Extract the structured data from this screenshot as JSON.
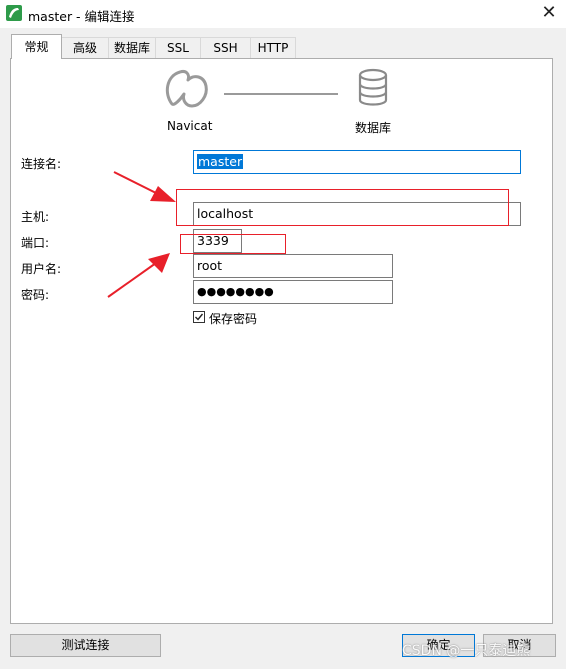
{
  "window": {
    "title": "master - 编辑连接"
  },
  "tabs": [
    {
      "label": "常规"
    },
    {
      "label": "高级"
    },
    {
      "label": "数据库"
    },
    {
      "label": "SSL"
    },
    {
      "label": "SSH"
    },
    {
      "label": "HTTP"
    }
  ],
  "active_tab": "常规",
  "diagram": {
    "left_label": "Navicat",
    "right_label": "数据库"
  },
  "form": {
    "connection_name_label": "连接名:",
    "connection_name_value": "master",
    "host_label": "主机:",
    "host_value": "localhost",
    "port_label": "端口:",
    "port_value": "3339",
    "user_label": "用户名:",
    "user_value": "root",
    "password_label": "密码:",
    "password_value": "●●●●●●●●",
    "save_password_label": "保存密码",
    "save_password_checked": true
  },
  "buttons": {
    "test": "测试连接",
    "ok": "确定",
    "cancel": "取消"
  },
  "watermark": "CSDN @一只泰迪熊",
  "colors": {
    "annotation_red": "#e8202a",
    "accent": "#0078d7"
  }
}
